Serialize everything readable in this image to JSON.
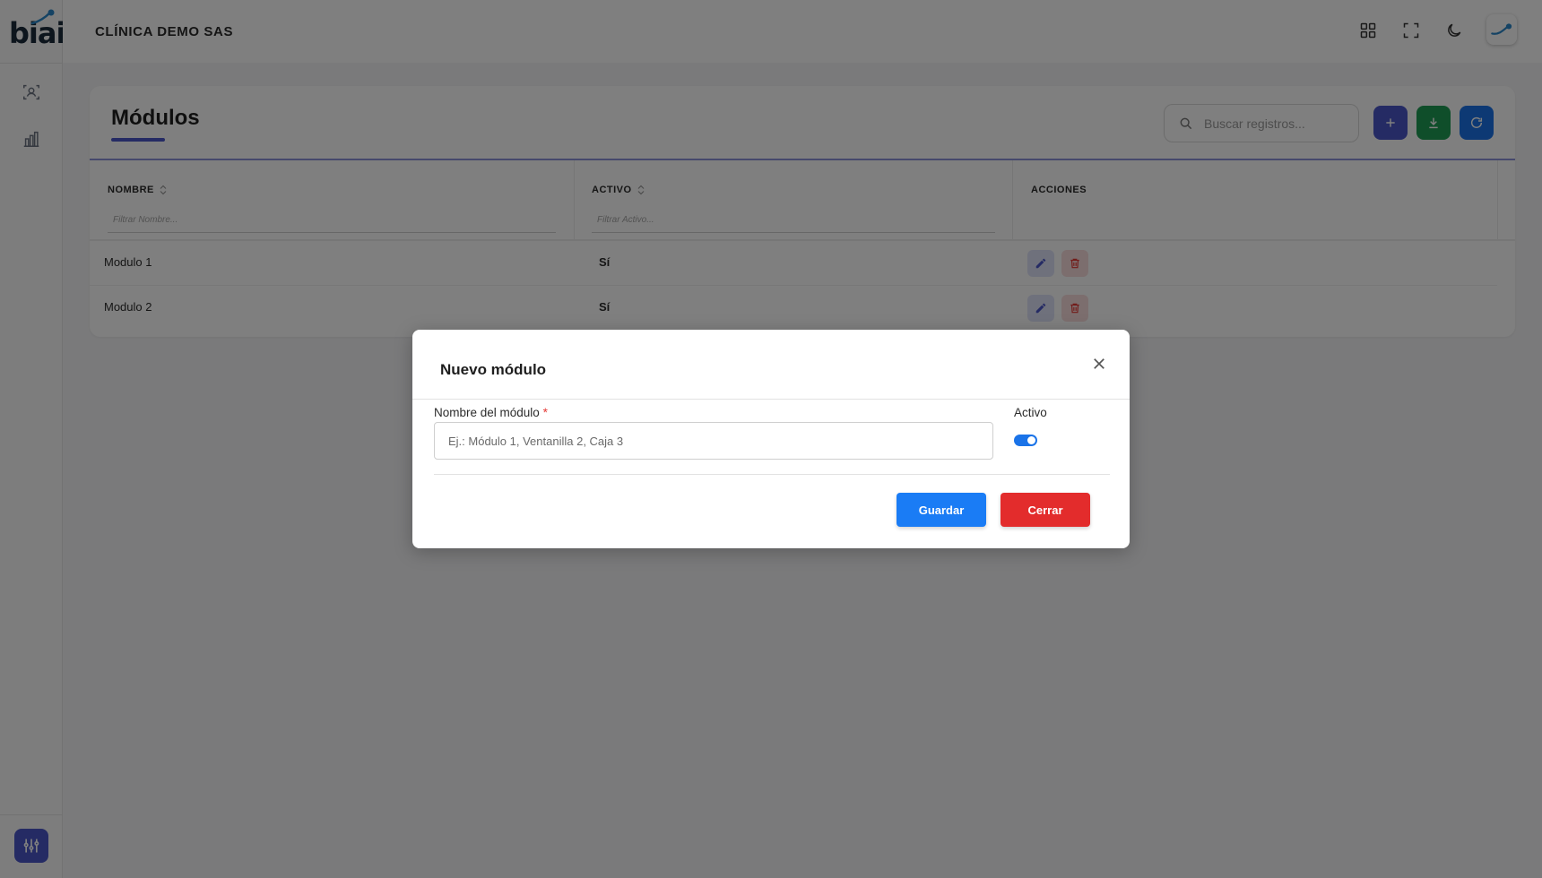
{
  "app": {
    "logo_text": "biai",
    "company_name": "CLÍNICA DEMO SAS"
  },
  "sidebar": {
    "items": [
      {
        "icon": "user-scan-icon"
      },
      {
        "icon": "bar-chart-icon"
      }
    ],
    "settings_icon": "sliders-icon"
  },
  "topbar": {
    "icons": [
      "grid-icon",
      "fullscreen-icon",
      "moon-icon",
      "avatar-logo"
    ]
  },
  "page": {
    "title": "Módulos",
    "search_placeholder": "Buscar registros...",
    "accent": "#4a56c8"
  },
  "table": {
    "columns": [
      {
        "label": "NOMBRE",
        "filter_placeholder": "Filtrar Nombre..."
      },
      {
        "label": "ACTIVO",
        "filter_placeholder": "Filtrar Activo..."
      },
      {
        "label": "ACCIONES"
      }
    ],
    "rows": [
      {
        "nombre": "Modulo 1",
        "activo": "Sí"
      },
      {
        "nombre": "Modulo 2",
        "activo": "Sí"
      }
    ]
  },
  "modal": {
    "title": "Nuevo módulo",
    "field_label": "Nombre del módulo",
    "required_mark": "*",
    "field_placeholder": "Ej.: Módulo 1, Ventanilla 2, Caja 3",
    "toggle_label": "Activo",
    "toggle_on": true,
    "save_label": "Guardar",
    "close_label": "Cerrar"
  },
  "colors": {
    "primary": "#1a7cf5",
    "danger": "#e32c2c",
    "export": "#1f9d55",
    "add": "#4a56c8",
    "refresh": "#1a73e8"
  }
}
